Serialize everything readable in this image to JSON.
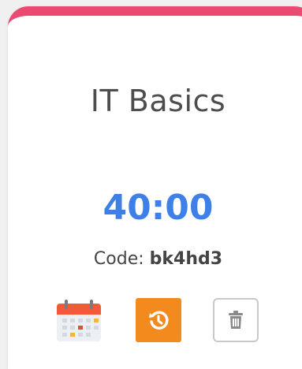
{
  "card": {
    "title": "IT Basics",
    "time": "40:00",
    "code_label": "Code:",
    "code_value": "bk4hd3",
    "accent_color": "#e84a72"
  },
  "actions": [
    {
      "name": "calendar",
      "icon": "calendar-icon"
    },
    {
      "name": "reset",
      "icon": "reset-timer-icon",
      "color": "#f28a1e"
    },
    {
      "name": "delete",
      "icon": "trash-icon"
    }
  ]
}
